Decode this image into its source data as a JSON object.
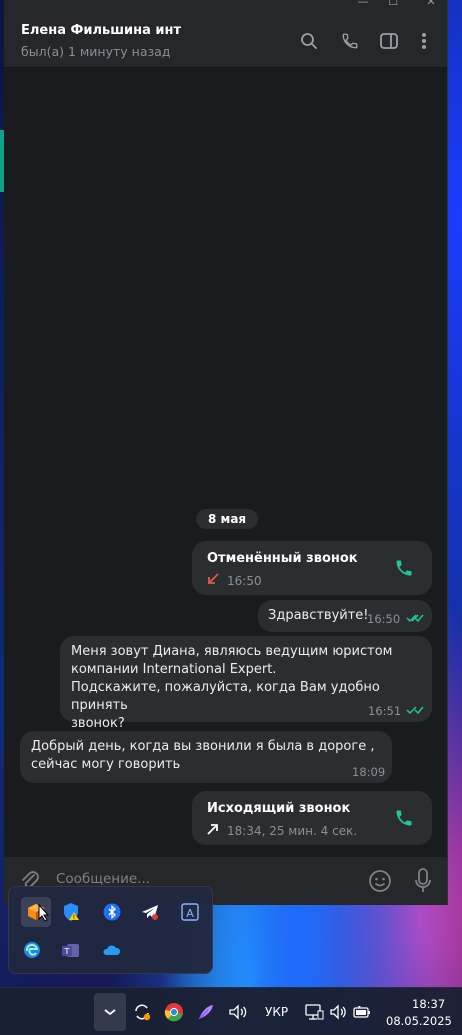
{
  "chat": {
    "contact_name": "Елена Фильшина инт",
    "status": "был(а) 1 минуту назад"
  },
  "messages": {
    "date_separator": "8 мая",
    "call_cancelled": {
      "title": "Отменённый звонок",
      "time": "16:50"
    },
    "msg_hello": {
      "text": "Здравствуйте!",
      "time": "16:50"
    },
    "msg_intro": {
      "line1": "Меня зовут Диана, являюсь ведущим юристом",
      "line2": "компании International Expert.",
      "line3": "Подскажите, пожалуйста, когда Вам удобно принять",
      "line4": "звонок?",
      "time": "16:51"
    },
    "msg_reply": {
      "line1": "Добрый день, когда вы звонили я была в дороге ,",
      "line2": "сейчас могу говорить",
      "time": "18:09"
    },
    "call_outgoing": {
      "title": "Исходящий звонок",
      "details": "18:34, 25 мин. 4 сек."
    }
  },
  "composer": {
    "placeholder": "Сообщение..."
  },
  "taskbar": {
    "language": "УКР",
    "time": "18:37",
    "date": "08.05.2025"
  },
  "colors": {
    "accent": "#0fa38c",
    "missed_call": "#e05a4a",
    "outgoing_call": "#ffffff",
    "bubble": "#2b2d31",
    "background": "#1a1b1e"
  },
  "icons": {
    "header": [
      "search-icon",
      "phone-icon",
      "sidebar-toggle-icon",
      "more-icon"
    ],
    "tray": [
      "cube-app-icon",
      "security-warning-icon",
      "bluetooth-icon",
      "telegram-icon",
      "text-input-icon",
      "edge-icon",
      "teams-icon",
      "onedrive-icon"
    ],
    "taskbar": [
      "chevron-up-icon",
      "sync-icon",
      "chrome-icon",
      "feather-icon",
      "volume-icon",
      "display-icon",
      "speaker-icon",
      "battery-icon"
    ]
  }
}
